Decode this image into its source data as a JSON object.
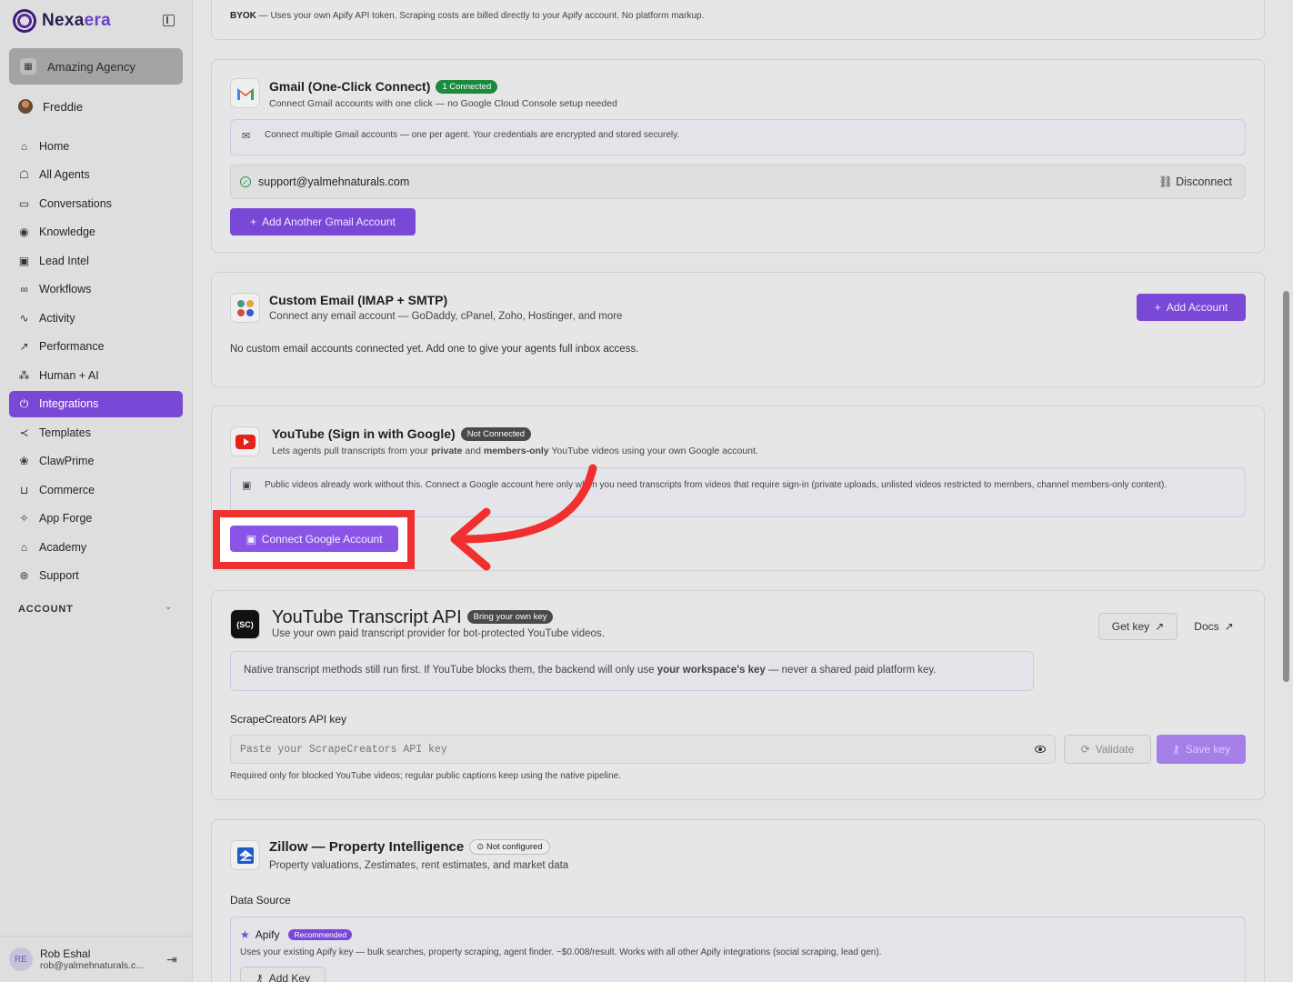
{
  "brand": {
    "name_part1": "Nexa",
    "name_part2": "era"
  },
  "sidebar": {
    "org": "Amazing Agency",
    "user": "Freddie",
    "items": [
      {
        "label": "Home",
        "icon": "home-icon",
        "glyph": "⌂"
      },
      {
        "label": "All Agents",
        "icon": "bot-icon",
        "glyph": "☖"
      },
      {
        "label": "Conversations",
        "icon": "chat-icon",
        "glyph": "▭"
      },
      {
        "label": "Knowledge",
        "icon": "brain-icon",
        "glyph": "◉"
      },
      {
        "label": "Lead Intel",
        "icon": "contact-icon",
        "glyph": "▣"
      },
      {
        "label": "Workflows",
        "icon": "workflow-icon",
        "glyph": "∞"
      },
      {
        "label": "Activity",
        "icon": "activity-icon",
        "glyph": "∿"
      },
      {
        "label": "Performance",
        "icon": "trend-icon",
        "glyph": "↗"
      },
      {
        "label": "Human + AI",
        "icon": "network-icon",
        "glyph": "⁂"
      },
      {
        "label": "Integrations",
        "icon": "plug-icon",
        "glyph": "⏻",
        "active": true
      },
      {
        "label": "Templates",
        "icon": "share-icon",
        "glyph": "≺"
      },
      {
        "label": "ClawPrime",
        "icon": "paw-icon",
        "glyph": "❀"
      },
      {
        "label": "Commerce",
        "icon": "cart-icon",
        "glyph": "⊔"
      },
      {
        "label": "App Forge",
        "icon": "sparkle-icon",
        "glyph": "✧"
      },
      {
        "label": "Academy",
        "icon": "graduation-icon",
        "glyph": "⌂"
      },
      {
        "label": "Support",
        "icon": "lifebuoy-icon",
        "glyph": "⊛"
      }
    ],
    "account_label": "ACCOUNT",
    "footer": {
      "initials": "RE",
      "name": "Rob Eshal",
      "email": "rob@yalmehnaturals.c..."
    }
  },
  "byok": {
    "prefix": "BYOK",
    "text": " — Uses your own Apify API token. Scraping costs are billed directly to your Apify account. No platform markup."
  },
  "gmail": {
    "title": "Gmail (One-Click Connect)",
    "badge": "1 Connected",
    "subtitle": "Connect Gmail accounts with one click — no Google Cloud Console setup needed",
    "info": "Connect multiple Gmail accounts — one per agent. Your credentials are encrypted and stored securely.",
    "account": "support@yalmehnaturals.com",
    "disconnect": "Disconnect",
    "add_button": "Add Another Gmail Account"
  },
  "custom_email": {
    "title": "Custom Email (IMAP + SMTP)",
    "subtitle": "Connect any email account — GoDaddy, cPanel, Zoho, Hostinger, and more",
    "add_button": "Add Account",
    "empty": "No custom email accounts connected yet. Add one to give your agents full inbox access."
  },
  "youtube": {
    "title": "YouTube (Sign in with Google)",
    "badge": "Not Connected",
    "subtitle_a": "Lets agents pull transcripts from your ",
    "subtitle_b": "private",
    "subtitle_c": " and ",
    "subtitle_d": "members-only",
    "subtitle_e": " YouTube videos using your own Google account.",
    "info": "Public videos already work without this. Connect a Google account here only when you need transcripts from videos that require sign-in (private uploads, unlisted videos restricted to members, channel members-only content).",
    "connect_button": "Connect Google Account"
  },
  "transcript_api": {
    "logo": "(SC)",
    "title": "YouTube Transcript API",
    "badge": "Bring your own key",
    "subtitle": "Use your own paid transcript provider for bot-protected YouTube videos.",
    "get_key": "Get key",
    "docs": "Docs",
    "note_a": "Native transcript methods still run first. If YouTube blocks them, the backend will only use ",
    "note_b": "your workspace's key",
    "note_c": " — never a shared paid platform key.",
    "field_label": "ScrapeCreators API key",
    "placeholder": "Paste your ScrapeCreators API key",
    "validate": "Validate",
    "save": "Save key",
    "help": "Required only for blocked YouTube videos; regular public captions keep using the native pipeline."
  },
  "zillow": {
    "title": "Zillow — Property Intelligence",
    "badge": "Not configured",
    "subtitle": "Property valuations, Zestimates, rent estimates, and market data",
    "source_label": "Data Source",
    "apify_name": "Apify",
    "apify_badge": "Recommended",
    "apify_desc": "Uses your existing Apify key — bulk searches, property scraping, agent finder. ~$0.008/result. Works with all other Apify integrations (social scraping, lead gen).",
    "add_key": "Add Key"
  },
  "colors": {
    "accent": "#7a48d6",
    "connected": "#1c8a3d",
    "annotation": "#f12f2f"
  }
}
